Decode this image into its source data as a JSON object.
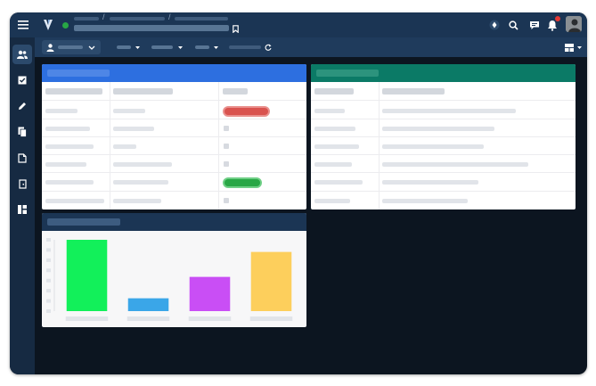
{
  "app": {
    "logo": "logo-icon",
    "status_color": "#28a745"
  },
  "header": {
    "breadcrumbs": [
      "",
      "",
      ""
    ],
    "doc_title": "",
    "icons": [
      "menu-icon",
      "apps-icon",
      "search-icon",
      "chat-icon",
      "bell-icon",
      "avatar"
    ],
    "notification_color": "#e53935"
  },
  "subbar": {
    "user_label": "",
    "menus": [
      "",
      "",
      ""
    ],
    "status_text": "",
    "layout_icon": "layout-icon"
  },
  "sidebar": {
    "items": [
      "users-icon",
      "checkbox-icon",
      "pencil-icon",
      "copy-icon",
      "document-icon",
      "exit-icon",
      "dashboard-icon"
    ]
  },
  "panels": {
    "blue": {
      "title": "",
      "accent": "#2d6fe0",
      "headers": [
        "",
        "",
        ""
      ],
      "rows": [
        {
          "c1": "",
          "c2": "",
          "status": "red"
        },
        {
          "c1": "",
          "c2": "",
          "status": ""
        },
        {
          "c1": "",
          "c2": "",
          "status": ""
        },
        {
          "c1": "",
          "c2": "",
          "status": ""
        },
        {
          "c1": "",
          "c2": "",
          "status": "green"
        },
        {
          "c1": "",
          "c2": "",
          "status": ""
        }
      ]
    },
    "green": {
      "title": "",
      "accent": "#0b7a66",
      "headers": [
        "",
        ""
      ],
      "rows": [
        {
          "c1": "",
          "c2": ""
        },
        {
          "c1": "",
          "c2": ""
        },
        {
          "c1": "",
          "c2": ""
        },
        {
          "c1": "",
          "c2": ""
        },
        {
          "c1": "",
          "c2": ""
        },
        {
          "c1": "",
          "c2": ""
        }
      ]
    },
    "chart": {
      "title": "",
      "accent": "#1b3554"
    }
  },
  "chart_data": {
    "type": "bar",
    "categories": [
      "",
      "",
      "",
      ""
    ],
    "values": [
      100,
      18,
      48,
      83
    ],
    "colors": [
      "#12f05a",
      "#3aa6e8",
      "#c94ef5",
      "#fdcf5c"
    ],
    "title": "",
    "xlabel": "",
    "ylabel": "",
    "ylim": [
      0,
      100
    ],
    "grid": false
  }
}
